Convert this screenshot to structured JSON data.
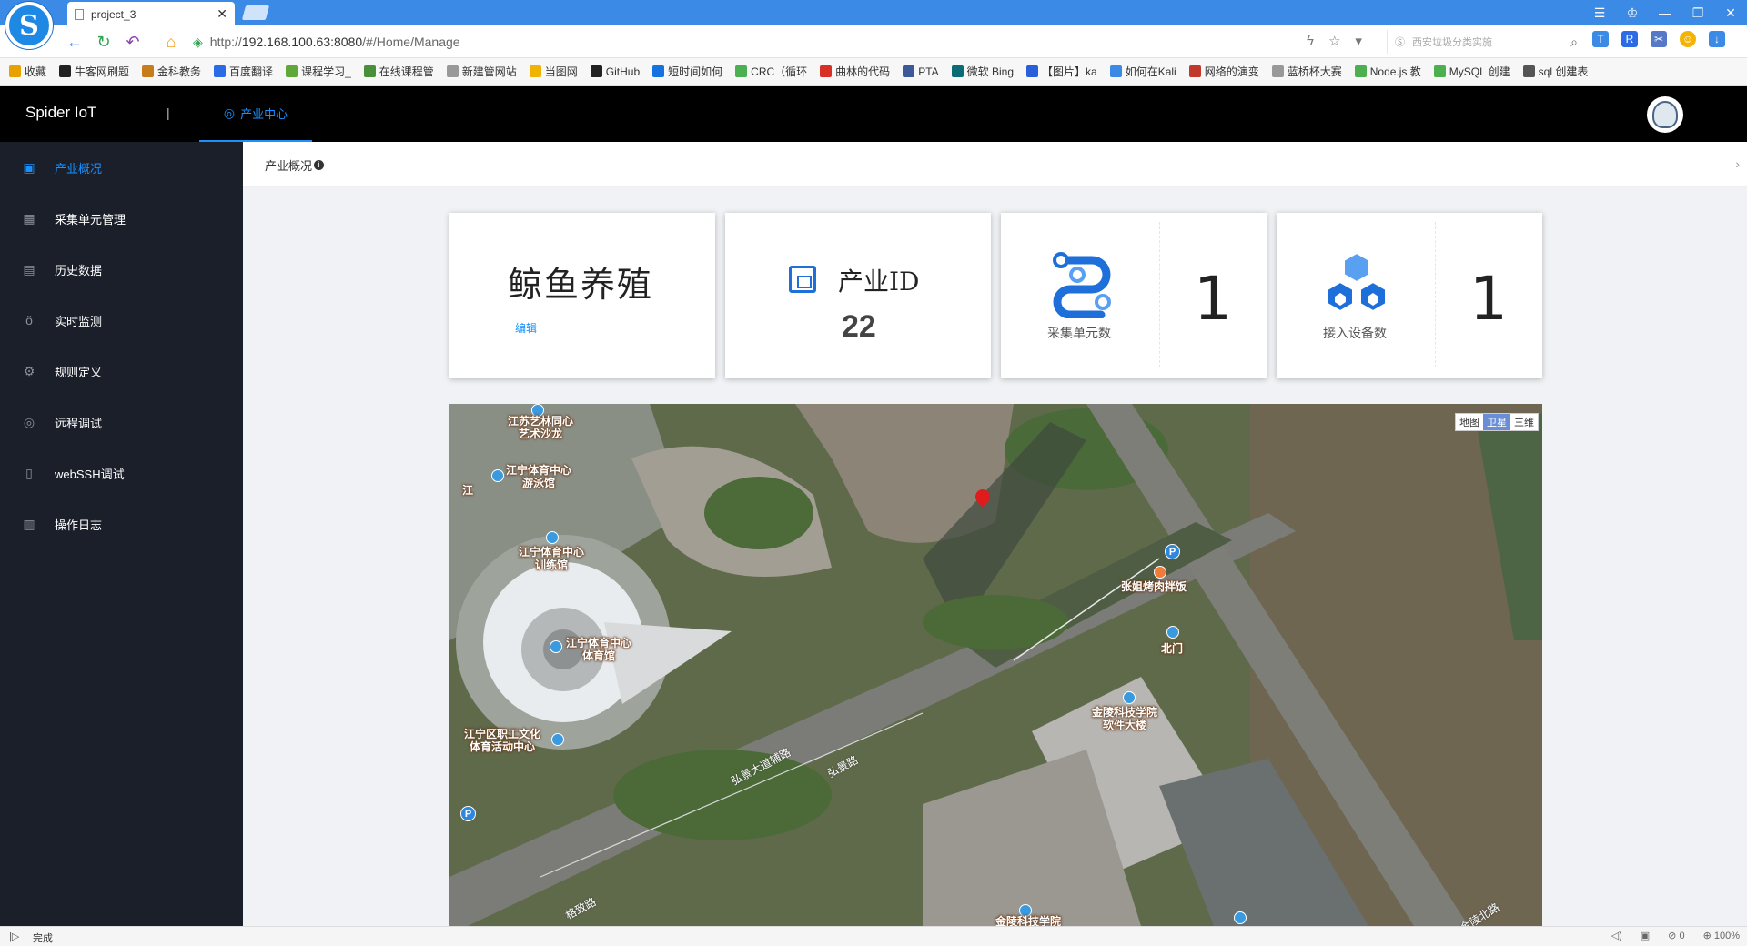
{
  "browser": {
    "tab_title": "project_3",
    "url_prefix": "http://",
    "url_host": "192.168.100.63:8080",
    "url_path": "/#/Home/Manage",
    "search_placeholder": "西安垃圾分类实施",
    "bookmarks": [
      {
        "label": "收藏",
        "icon": "star-icon",
        "color": "#e8a100"
      },
      {
        "label": "牛客网刷题",
        "icon": "nowcoder-icon",
        "color": "#222222"
      },
      {
        "label": "金科教务",
        "icon": "school-icon",
        "color": "#c77d1a"
      },
      {
        "label": "百度翻译",
        "icon": "translate-icon",
        "color": "#2b6ce6"
      },
      {
        "label": "课程学习_",
        "icon": "course-icon",
        "color": "#61a83a"
      },
      {
        "label": "在线课程管",
        "icon": "online-course-icon",
        "color": "#4a8f3a"
      },
      {
        "label": "新建管网站",
        "icon": "page-icon",
        "color": "#999999"
      },
      {
        "label": "当图网",
        "icon": "dangtu-icon",
        "color": "#f0b400"
      },
      {
        "label": "GitHub",
        "icon": "github-icon",
        "color": "#222222"
      },
      {
        "label": "短时间如何",
        "icon": "zhihu-icon",
        "color": "#1672e0"
      },
      {
        "label": "CRC（循环",
        "icon": "crc-icon",
        "color": "#4caf50"
      },
      {
        "label": "曲林的代码",
        "icon": "csdn-icon",
        "color": "#d93025"
      },
      {
        "label": "PTA",
        "icon": "pta-icon",
        "color": "#3c5a99"
      },
      {
        "label": "微软 Bing",
        "icon": "bing-icon",
        "color": "#0a6c74"
      },
      {
        "label": "【图片】ka",
        "icon": "baidu-paw-icon",
        "color": "#2b5fd9"
      },
      {
        "label": "如何在Kali",
        "icon": "cloud-icon",
        "color": "#3b8ae6"
      },
      {
        "label": "网络的演变",
        "icon": "network-icon",
        "color": "#c0392b"
      },
      {
        "label": "蓝桥杯大赛",
        "icon": "page-icon",
        "color": "#999999"
      },
      {
        "label": "Node.js 教",
        "icon": "runoob-icon",
        "color": "#4caf50"
      },
      {
        "label": "MySQL 创建",
        "icon": "runoob-icon",
        "color": "#4caf50"
      },
      {
        "label": "sql 创建表",
        "icon": "sql-icon",
        "color": "#555555"
      }
    ]
  },
  "header": {
    "brand": "Spider IoT",
    "divider": "|",
    "nav_label": "产业中心"
  },
  "sidebar": {
    "items": [
      {
        "label": "产业概况",
        "icon": "overview-icon",
        "active": true
      },
      {
        "label": "采集单元管理",
        "icon": "grid-icon",
        "active": false
      },
      {
        "label": "历史数据",
        "icon": "document-icon",
        "active": false
      },
      {
        "label": "实时监测",
        "icon": "thermometer-icon",
        "active": false
      },
      {
        "label": "规则定义",
        "icon": "gear-icon",
        "active": false
      },
      {
        "label": "远程调试",
        "icon": "remote-icon",
        "active": false
      },
      {
        "label": "webSSH调试",
        "icon": "bottle-icon",
        "active": false
      },
      {
        "label": "操作日志",
        "icon": "log-icon",
        "active": false
      }
    ]
  },
  "breadcrumb": {
    "label": "产业概况",
    "info": "i"
  },
  "cards": {
    "industry_name": "鲸鱼养殖",
    "edit_label": "编辑",
    "id_label": "产业ID",
    "id_value": "22",
    "collector_label": "采集单元数",
    "collector_value": "1",
    "device_label": "接入设备数",
    "device_value": "1"
  },
  "map": {
    "type_buttons": [
      "地图",
      "卫星",
      "三维"
    ],
    "active_type": "卫星",
    "pois": {
      "art_center": "江苏艺林同心\n艺术沙龙",
      "swim": "江宁体育中心\n游泳馆",
      "train": "江宁体育中心\n训练馆",
      "gym": "江宁体育中心\n体育馆",
      "culture": "江宁区职工文化\n体育活动中心",
      "restaurant": "张姐烤肉拌饭",
      "north_gate": "北门",
      "software": "金陵科技学院\n软件大楼",
      "jiang": "江",
      "college": "金陵科技学院"
    },
    "roads": {
      "r1": "弘景大道辅路",
      "r2": "弘景路",
      "r3": "格致路",
      "r4": "金陵北路"
    },
    "parking": "P"
  },
  "status": {
    "play": "|▷",
    "text": "完成",
    "zoom": "100%",
    "count": "0"
  },
  "colors": {
    "accent": "#1890ff",
    "header_bg": "#000000",
    "sidebar_bg": "#1b1f2a"
  }
}
